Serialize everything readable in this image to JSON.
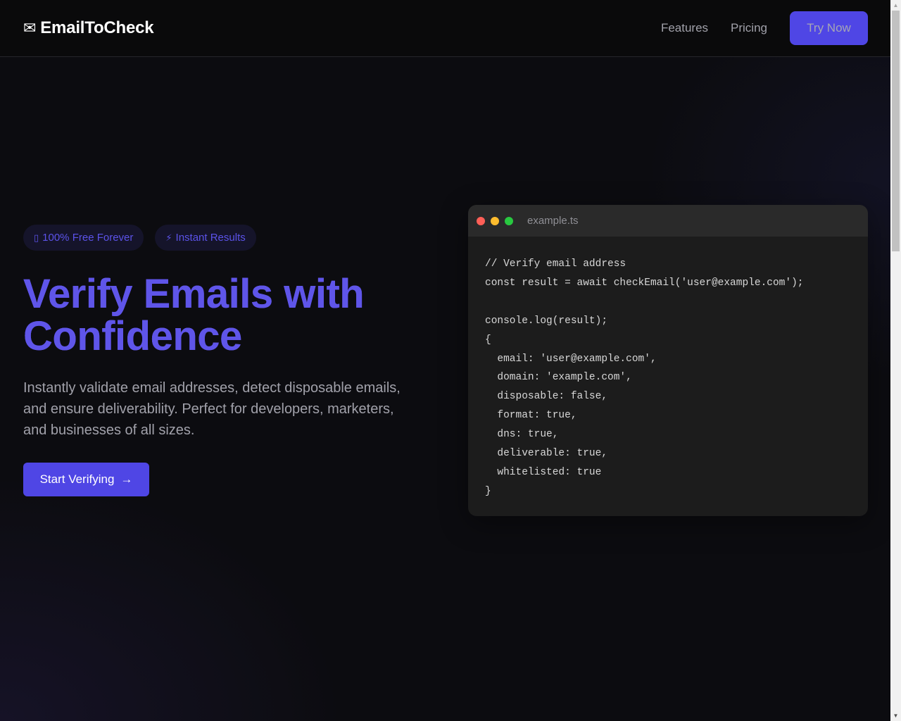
{
  "header": {
    "logo_icon": "✉",
    "logo_text": "EmailToCheck",
    "nav": [
      {
        "label": "Features"
      },
      {
        "label": "Pricing"
      }
    ],
    "cta_label": "Try Now"
  },
  "hero": {
    "badges": [
      {
        "icon": "▯",
        "icon_name": "missing-glyph-icon",
        "label": "100% Free Forever"
      },
      {
        "icon": "⚡",
        "icon_name": "lightning-icon",
        "label": "Instant Results"
      }
    ],
    "title": "Verify Emails with Confidence",
    "description": "Instantly validate email addresses, detect disposable emails, and ensure deliverability. Perfect for developers, marketers, and businesses of all sizes.",
    "cta_label": "Start Verifying",
    "cta_arrow": "→"
  },
  "code_window": {
    "filename": "example.ts",
    "lines": [
      "// Verify email address",
      "const result = await checkEmail('user@example.com');",
      "",
      "console.log(result);",
      "{",
      "  email: 'user@example.com',",
      "  domain: 'example.com',",
      "  disposable: false,",
      "  format: true,",
      "  dns: true,",
      "  deliverable: true,",
      "  whitelisted: true",
      "}"
    ]
  },
  "colors": {
    "accent": "#4f46e5",
    "title_gradient_start": "#5a50e8",
    "title_gradient_end": "#7b5cf0",
    "background": "#0a0a0b",
    "code_bg": "#1c1c1c"
  }
}
